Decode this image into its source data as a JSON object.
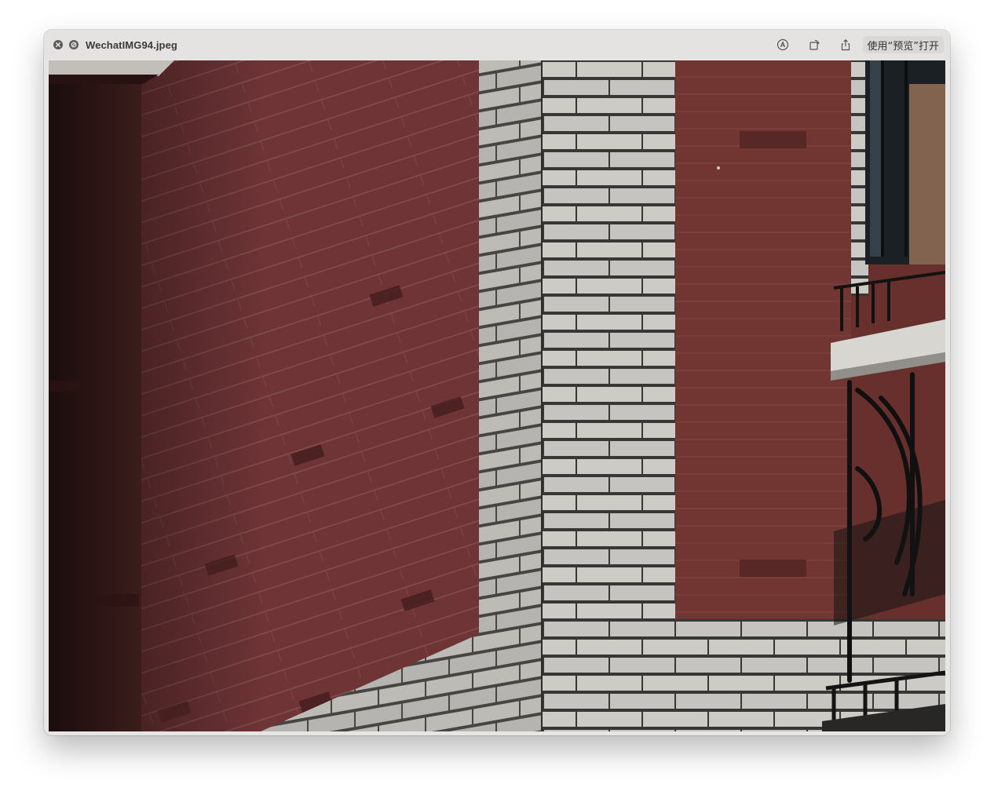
{
  "window": {
    "title": "WechatIMG94.jpeg"
  },
  "toolbar": {
    "markup_icon": "markup-icon",
    "rotate_icon": "rotate-icon",
    "share_icon": "share-icon",
    "open_with_label": "使用“预览”打开"
  },
  "titlebar": {
    "close_icon": "close-icon",
    "fullscreen_icon": "block-icon"
  },
  "colors": {
    "brick_red": "#7a3a35",
    "brick_dark": "#4a2220",
    "tile_white": "#d9d8d4",
    "mortar": "#3a3a38"
  }
}
